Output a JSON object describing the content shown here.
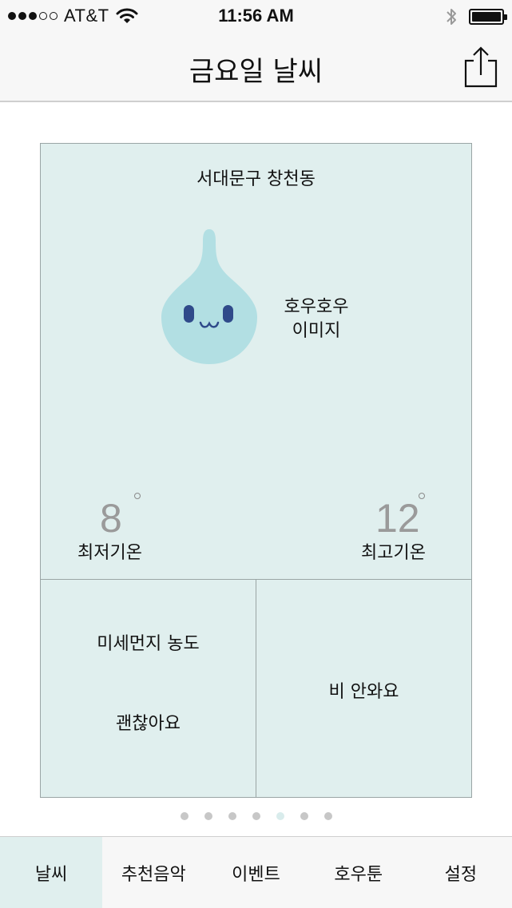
{
  "status_bar": {
    "carrier": "AT&T",
    "signal_dots": [
      true,
      true,
      true,
      false,
      false
    ],
    "time": "11:56 AM",
    "icons": [
      "wifi-icon",
      "bluetooth-icon",
      "battery-icon"
    ],
    "battery_level": 1.0
  },
  "nav": {
    "title": "금요일 날씨",
    "share_icon": "share-icon"
  },
  "weather": {
    "location": "서대문구 창천동",
    "mascot_label_line1": "호우호우",
    "mascot_label_line2": "이미지",
    "low_temp": "8",
    "low_label": "최저기온",
    "high_temp": "12",
    "high_label": "최고기온",
    "dust_title": "미세먼지 농도",
    "dust_value": "괜찮아요",
    "rain_text": "비 안와요"
  },
  "page_dots": {
    "count": 7,
    "active_index": 4
  },
  "tabs": [
    {
      "label": "날씨",
      "active": true
    },
    {
      "label": "추천음악",
      "active": false
    },
    {
      "label": "이벤트",
      "active": false
    },
    {
      "label": "호우툰",
      "active": false
    },
    {
      "label": "설정",
      "active": false
    }
  ],
  "colors": {
    "card_background": "#e0efee",
    "mascot_body": "#b2dfe3",
    "mascot_face": "#2f4a8a",
    "active_tab": "#e0efee"
  }
}
